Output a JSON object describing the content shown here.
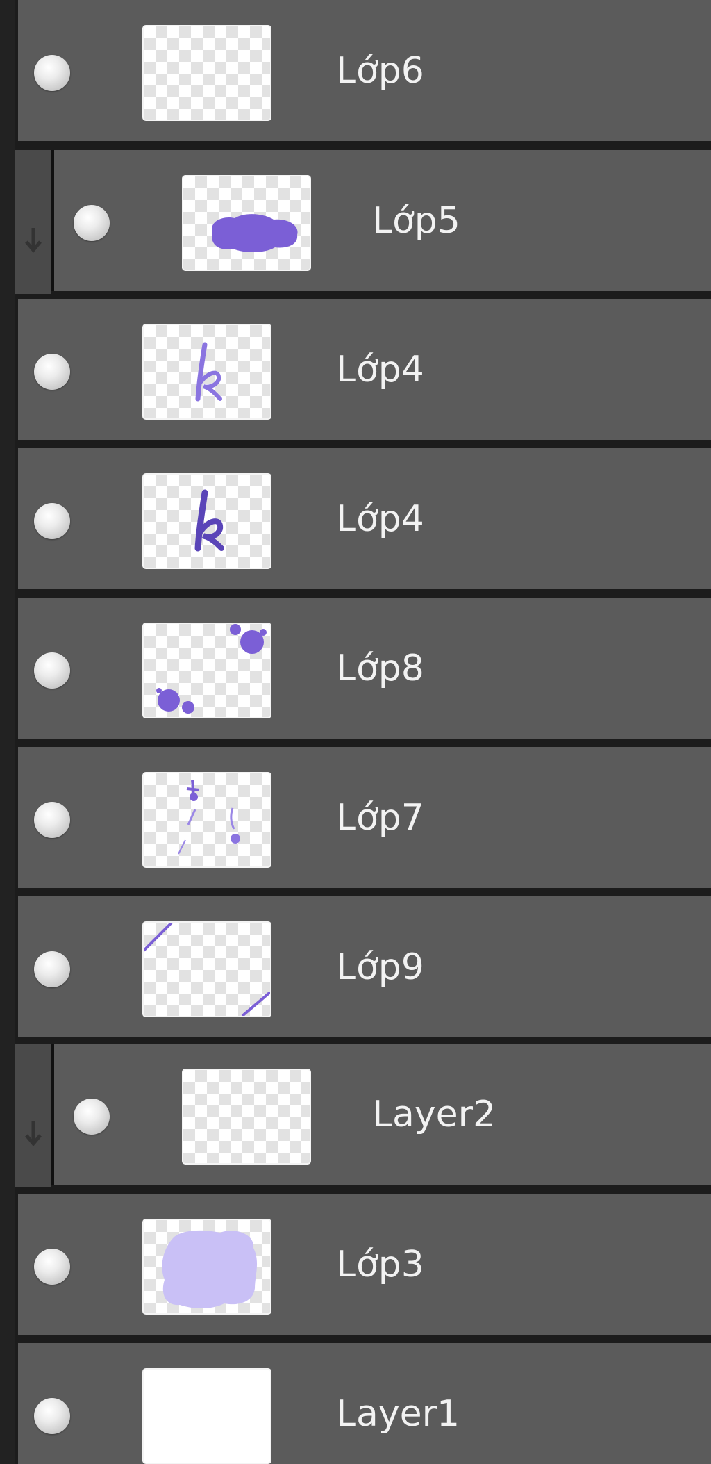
{
  "layers_panel": {
    "accent_color": "#7b5fd6",
    "layers": [
      {
        "name": "Lớp6",
        "visibility_icon": "eye-visible-icon",
        "thumbnail": "empty"
      },
      {
        "name": "Lớp5",
        "visibility_icon": "eye-visible-icon",
        "thumbnail": "purple-blob",
        "clipped": true
      },
      {
        "name": "Lớp4",
        "visibility_icon": "eye-visible-icon",
        "thumbnail": "letter-k-light"
      },
      {
        "name": "Lớp4",
        "visibility_icon": "eye-visible-icon",
        "thumbnail": "letter-k-dark"
      },
      {
        "name": "Lớp8",
        "visibility_icon": "eye-visible-icon",
        "thumbnail": "purple-dots"
      },
      {
        "name": "Lớp7",
        "visibility_icon": "eye-visible-icon",
        "thumbnail": "purple-sketch"
      },
      {
        "name": "Lớp9",
        "visibility_icon": "eye-visible-icon",
        "thumbnail": "diagonal-lines"
      },
      {
        "name": "Layer2",
        "visibility_icon": "eye-visible-icon",
        "thumbnail": "empty",
        "clipped": true
      },
      {
        "name": "Lớp3",
        "visibility_icon": "eye-visible-icon",
        "thumbnail": "lavender-fill"
      },
      {
        "name": "Layer1",
        "visibility_icon": "eye-visible-icon",
        "thumbnail": "white-fill"
      }
    ]
  }
}
